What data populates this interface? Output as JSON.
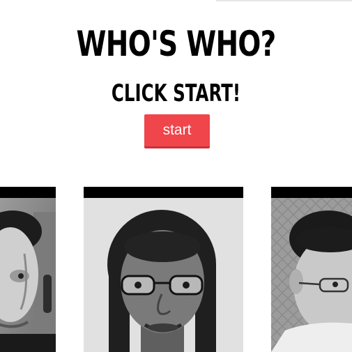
{
  "header": {
    "title": "WHO'S WHO?",
    "subtitle": "CLICK START!",
    "start_label": "start"
  },
  "colors": {
    "start_button": "#f0454b",
    "card_bar": "#000000"
  },
  "cards": [
    {
      "id": "person-1",
      "description_icon": "portrait-man-left"
    },
    {
      "id": "person-2",
      "description_icon": "portrait-woman-glasses"
    },
    {
      "id": "person-3",
      "description_icon": "portrait-man-glasses"
    }
  ]
}
